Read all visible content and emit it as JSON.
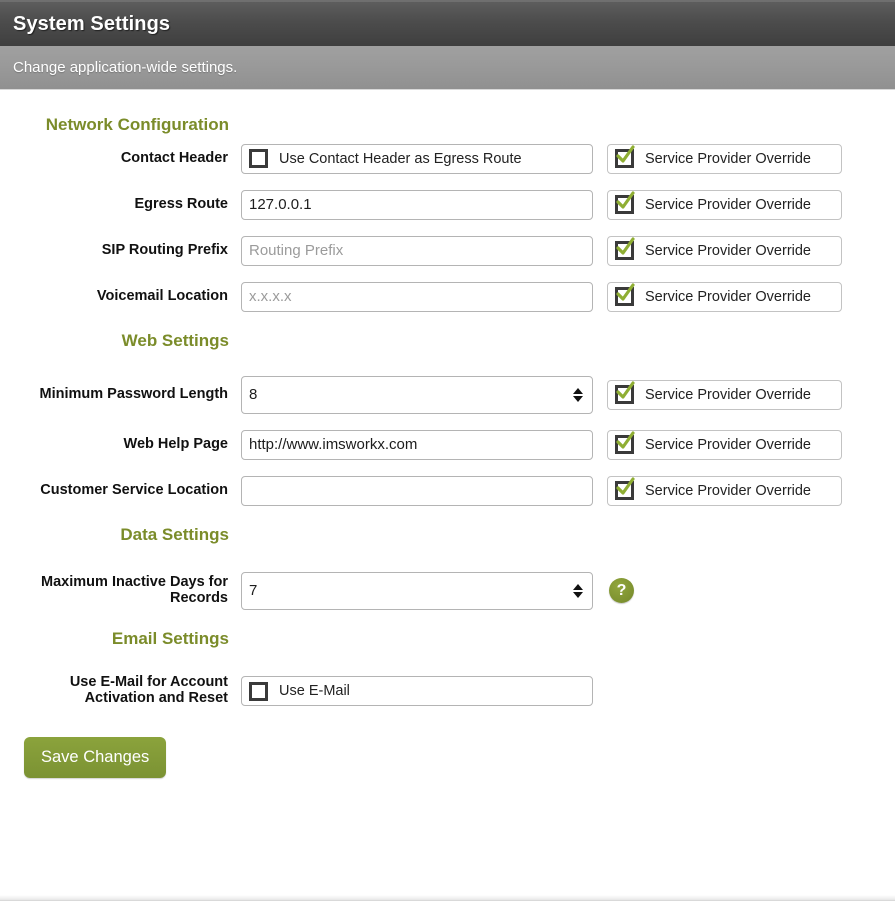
{
  "header": {
    "title": "System Settings",
    "subtitle": "Change application-wide settings."
  },
  "colors": {
    "section_heading": "#7b8c2a",
    "accent_green": "#7b9233",
    "titlebar": "#4c4c4c",
    "subbar": "#999999"
  },
  "common": {
    "override_label": "Service Provider Override",
    "help_icon_glyph": "?"
  },
  "sections": [
    {
      "heading": "Network Configuration",
      "rows": [
        {
          "label": "Contact Header",
          "control": "checkbox",
          "checkbox_label": "Use Contact Header as Egress Route",
          "checked": false,
          "override": true,
          "override_checked": true
        },
        {
          "label": "Egress Route",
          "control": "text",
          "value": "127.0.0.1",
          "placeholder": "",
          "override": true,
          "override_checked": true
        },
        {
          "label": "SIP Routing Prefix",
          "control": "text",
          "value": "",
          "placeholder": "Routing Prefix",
          "override": true,
          "override_checked": true
        },
        {
          "label": "Voicemail Location",
          "control": "text",
          "value": "",
          "placeholder": "x.x.x.x",
          "override": true,
          "override_checked": true
        }
      ]
    },
    {
      "heading": "Web Settings",
      "rows": [
        {
          "label": "Minimum Password Length",
          "control": "number",
          "value": "8",
          "override": true,
          "override_checked": true
        },
        {
          "label": "Web Help Page",
          "control": "text",
          "value": "http://www.imsworkx.com",
          "placeholder": "",
          "override": true,
          "override_checked": true
        },
        {
          "label": "Customer Service Location",
          "control": "text",
          "value": "",
          "placeholder": "",
          "override": true,
          "override_checked": true
        }
      ]
    },
    {
      "heading": "Data Settings",
      "rows": [
        {
          "label": "Maximum Inactive Days for Records",
          "control": "number",
          "value": "7",
          "override": false,
          "help": true
        }
      ]
    },
    {
      "heading": "Email Settings",
      "rows": [
        {
          "label": "Use E-Mail for Account Activation and Reset",
          "control": "checkbox",
          "checkbox_label": "Use E-Mail",
          "checked": false,
          "override": false
        }
      ]
    }
  ],
  "footer": {
    "save_label": "Save Changes"
  }
}
